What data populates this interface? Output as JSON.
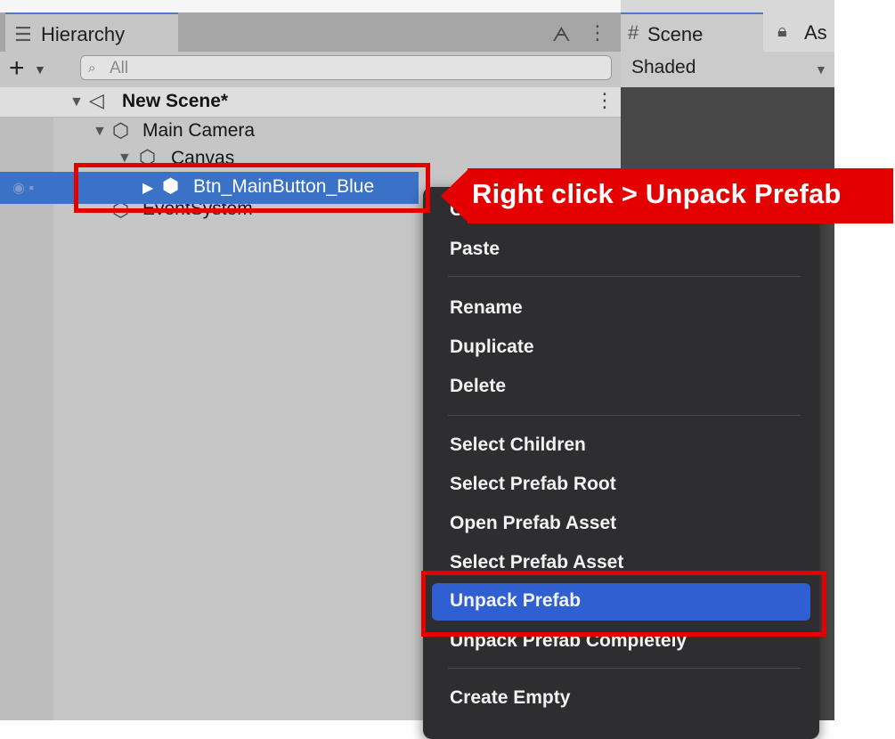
{
  "hierarchy": {
    "tab_label": "Hierarchy",
    "search_placeholder": "All",
    "scene_name": "New Scene*",
    "items": [
      {
        "label": "Main Camera"
      },
      {
        "label": "Canvas"
      },
      {
        "label": "Btn_MainButton_Blue"
      },
      {
        "label": "EventSystem"
      }
    ]
  },
  "scene_panel": {
    "tab_label": "Scene",
    "asset_tab_label": "As",
    "shading_mode": "Shaded"
  },
  "context_menu": {
    "items": [
      {
        "label": "Copy"
      },
      {
        "label": "Paste"
      },
      {
        "label": "Rename"
      },
      {
        "label": "Duplicate"
      },
      {
        "label": "Delete"
      },
      {
        "label": "Select Children"
      },
      {
        "label": "Select Prefab Root"
      },
      {
        "label": "Open Prefab Asset"
      },
      {
        "label": "Select Prefab Asset"
      },
      {
        "label": "Unpack Prefab"
      },
      {
        "label": "Unpack Prefab Completely"
      },
      {
        "label": "Create Empty"
      }
    ],
    "highlighted": "Unpack Prefab"
  },
  "annotation": {
    "callout_text": "Right click > Unpack Prefab",
    "color": "#e50000"
  },
  "colors": {
    "selection_blue": "#3a72c8",
    "menu_highlight": "#2f5fd0"
  }
}
